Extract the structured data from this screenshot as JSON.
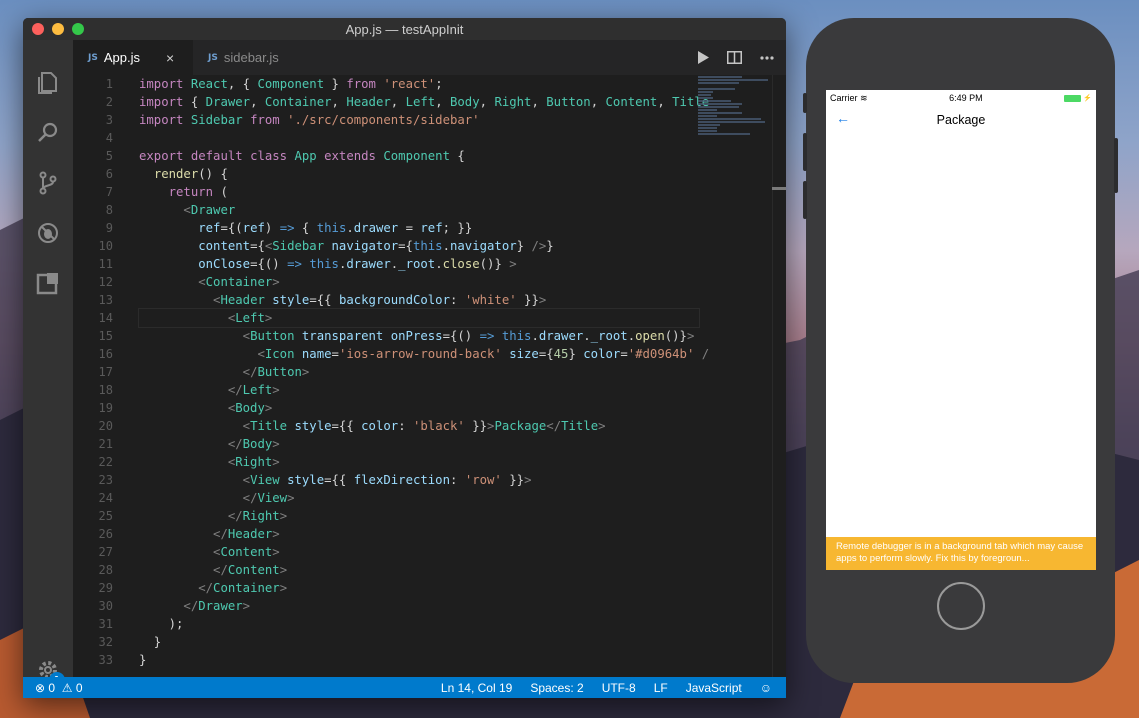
{
  "window": {
    "title": "App.js — testAppInit"
  },
  "tabs": [
    {
      "icon": "JS",
      "label": "App.js",
      "close": "×"
    },
    {
      "icon": "JS",
      "label": "sidebar.js"
    }
  ],
  "line_numbers": [
    "1",
    "2",
    "3",
    "4",
    "5",
    "6",
    "7",
    "8",
    "9",
    "10",
    "11",
    "12",
    "13",
    "14",
    "15",
    "16",
    "17",
    "18",
    "19",
    "20",
    "21",
    "22",
    "23",
    "24",
    "25",
    "26",
    "27",
    "28",
    "29",
    "30",
    "31",
    "32",
    "33"
  ],
  "code": [
    "import React, { Component } from 'react';",
    "import { Drawer, Container, Header, Left, Body, Right, Button, Content, Title",
    "import Sidebar from './src/components/sidebar'",
    "",
    "export default class App extends Component {",
    "  render() {",
    "    return (",
    "      <Drawer",
    "        ref={(ref) => { this.drawer = ref; }}",
    "        content={<Sidebar navigator={this.navigator} />}",
    "        onClose={() => this.drawer._root.close()} >",
    "        <Container>",
    "          <Header style={{ backgroundColor: 'white' }}>",
    "            <Left>",
    "              <Button transparent onPress={() => this.drawer._root.open()}>",
    "                <Icon name='ios-arrow-round-back' size={45} color='#d0964b' /",
    "              </Button>",
    "            </Left>",
    "            <Body>",
    "              <Title style={{ color: 'black' }}>Package</Title>",
    "            </Body>",
    "            <Right>",
    "              <View style={{ flexDirection: 'row' }}>",
    "              </View>",
    "            </Right>",
    "          </Header>",
    "          <Content>",
    "          </Content>",
    "        </Container>",
    "      </Drawer>",
    "    );",
    "  }",
    "}"
  ],
  "status": {
    "errors": "0",
    "warnings": "0",
    "position": "Ln 14, Col 19",
    "spaces": "Spaces: 2",
    "encoding": "UTF-8",
    "eol": "LF",
    "language": "JavaScript"
  },
  "activity_badge": "1",
  "simulator": {
    "carrier": "Carrier",
    "time": "6:49 PM",
    "nav_title": "Package",
    "warning": "Remote debugger is in a background tab which may cause apps to perform slowly. Fix this by foregroun..."
  }
}
